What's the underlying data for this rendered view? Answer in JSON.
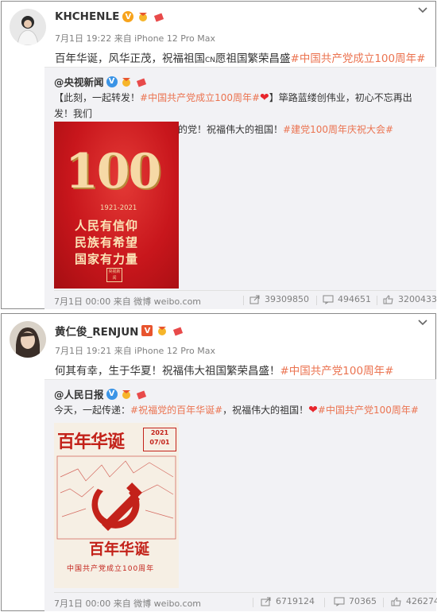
{
  "posts": [
    {
      "username": "KHCHENLE",
      "time": "7月1日 19:22 来自 iPhone 12 Pro Max",
      "text_main": "百年华诞，风华正茂，祝福祖国",
      "text_cn": "CN",
      "text_rest": "愿祖国繁荣昌盛",
      "topic": "#中国共产党成立100周年#",
      "repost": {
        "author": "@央视新闻",
        "line1_a": "【此刻，一起转发！",
        "line1_link": "#中国共产党成立100周年#",
        "line1_b": "】筚路蓝缕创伟业，初心不忘再出发！我们",
        "line2_a": "永远跟党走！转起，祝福伟大的党！祝福伟大的祖国！",
        "line2_link": "#建党100周年庆祝大会#",
        "poster": {
          "number": "100",
          "years": "1921-2021",
          "slogan1": "人民有信仰",
          "slogan2": "民族有希望",
          "slogan3": "国家有力量",
          "logo": "央视新闻"
        },
        "source": "7月1日 00:00 来自 微博 weibo.com",
        "shares": "39309850",
        "comments": "494651",
        "likes": "3200433"
      }
    },
    {
      "username": "黄仁俊_RENJUN",
      "time": "7月1日 19:21 来自 iPhone 12 Pro Max",
      "text_main": "何其有幸，生于华夏！祝福伟大祖国繁荣昌盛！",
      "topic": "#中国共产党100周年#",
      "repost": {
        "author": "@人民日报",
        "line1_a": "今天，一起传递：",
        "line1_link": "#祝福党的百年华诞#",
        "line1_b": "，祝福伟大的祖国！",
        "line1_link2": "#中国共产党100周年#",
        "poster": {
          "title": "百年华诞",
          "date_year": "2021",
          "date_day": "07/01",
          "footer_title": "百年华诞",
          "footer_sub": "中国共产党成立100周年"
        },
        "source": "7月1日 00:00 来自 微博 weibo.com",
        "shares": "6719124",
        "comments": "70365",
        "likes": "426274"
      }
    }
  ],
  "colors": {
    "topic": "#eb7350",
    "meta": "#808080",
    "repost_bg": "#f2f2f5",
    "poster_red": "#c8161c"
  }
}
